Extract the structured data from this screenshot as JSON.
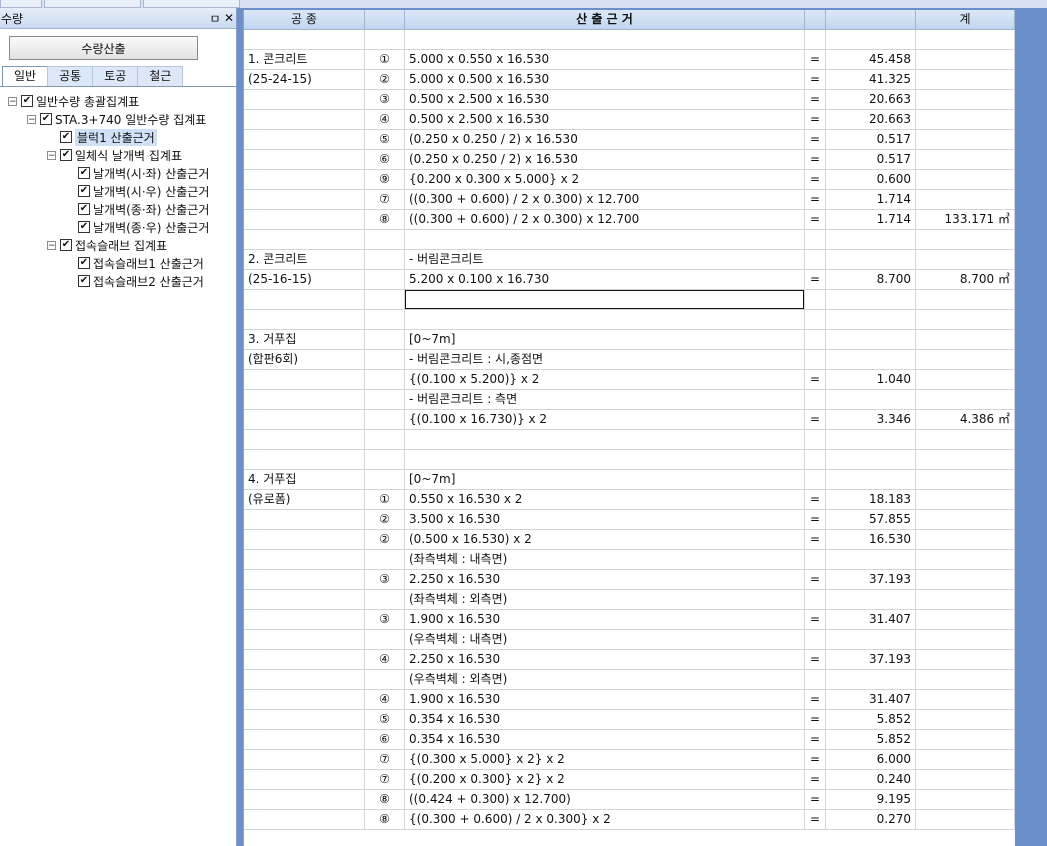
{
  "panel": {
    "title": "수량",
    "pin_glyph": "ㅁ",
    "close_glyph": "✕",
    "calc_button": "수량산출",
    "tabs": [
      "일반",
      "공통",
      "토공",
      "철근"
    ],
    "tree": [
      {
        "label": "일반수량 총괄집계표",
        "level": 0,
        "expander": "−",
        "checked": true
      },
      {
        "label": "STA.3+740 일반수량 집계표",
        "level": 1,
        "expander": "−",
        "checked": true
      },
      {
        "label": "블럭1 산출근거",
        "level": 2,
        "expander": "",
        "checked": true,
        "selected": true
      },
      {
        "label": "일체식 날개벽 집계표",
        "level": 2,
        "expander": "−",
        "checked": true
      },
      {
        "label": "날개벽(시·좌) 산출근거",
        "level": 3,
        "expander": "",
        "checked": true
      },
      {
        "label": "날개벽(시·우) 산출근거",
        "level": 3,
        "expander": "",
        "checked": true
      },
      {
        "label": "날개벽(종·좌) 산출근거",
        "level": 3,
        "expander": "",
        "checked": true
      },
      {
        "label": "날개벽(종·우) 산출근거",
        "level": 3,
        "expander": "",
        "checked": true
      },
      {
        "label": "접속슬래브 집계표",
        "level": 2,
        "expander": "−",
        "checked": true
      },
      {
        "label": "접속슬래브1 산출근거",
        "level": 3,
        "expander": "",
        "checked": true
      },
      {
        "label": "접속슬래브2 산출근거",
        "level": 3,
        "expander": "",
        "checked": true
      }
    ]
  },
  "sheet": {
    "headers": [
      "공 종",
      "",
      "산 출 근 거",
      "",
      "",
      "계"
    ],
    "rows": [
      [
        "",
        "",
        "",
        "",
        "",
        ""
      ],
      [
        "1. 콘크리트",
        "①",
        "5.000 x 0.550 x 16.530",
        "=",
        "45.458",
        ""
      ],
      [
        "(25-24-15)",
        "②",
        "5.000 x 0.500 x 16.530",
        "=",
        "41.325",
        ""
      ],
      [
        "",
        "③",
        "0.500 x 2.500 x 16.530",
        "=",
        "20.663",
        ""
      ],
      [
        "",
        "④",
        "0.500 x 2.500 x 16.530",
        "=",
        "20.663",
        ""
      ],
      [
        "",
        "⑤",
        "(0.250 x 0.250 / 2) x 16.530",
        "=",
        "0.517",
        ""
      ],
      [
        "",
        "⑥",
        "(0.250 x 0.250 / 2) x 16.530",
        "=",
        "0.517",
        ""
      ],
      [
        "",
        "⑨",
        "{0.200 x 0.300 x 5.000} x 2",
        "=",
        "0.600",
        ""
      ],
      [
        "",
        "⑦",
        "((0.300 + 0.600) / 2 x 0.300) x 12.700",
        "=",
        "1.714",
        ""
      ],
      [
        "",
        "⑧",
        "((0.300 + 0.600) / 2 x 0.300) x 12.700",
        "=",
        "1.714",
        "133.171 ㎥"
      ],
      [
        "",
        "",
        "",
        "",
        "",
        ""
      ],
      [
        "2. 콘크리트",
        "",
        "- 버림콘크리트",
        "",
        "",
        ""
      ],
      [
        "(25-16-15)",
        "",
        "5.200 x 0.100 x 16.730",
        "=",
        "8.700",
        "8.700 ㎥"
      ],
      [
        "",
        "",
        "",
        "",
        "",
        ""
      ],
      [
        "",
        "",
        "",
        "",
        "",
        ""
      ],
      [
        "3. 거푸집",
        "",
        "[0~7m]",
        "",
        "",
        ""
      ],
      [
        "(합판6회)",
        "",
        "- 버림콘크리트 : 시,종점면",
        "",
        "",
        ""
      ],
      [
        "",
        "",
        "{(0.100 x 5.200)} x 2",
        "=",
        "1.040",
        ""
      ],
      [
        "",
        "",
        "- 버림콘크리트 : 측면",
        "",
        "",
        ""
      ],
      [
        "",
        "",
        "{(0.100 x 16.730)} x 2",
        "=",
        "3.346",
        "4.386 ㎡"
      ],
      [
        "",
        "",
        "",
        "",
        "",
        ""
      ],
      [
        "",
        "",
        "",
        "",
        "",
        ""
      ],
      [
        "4. 거푸집",
        "",
        "[0~7m]",
        "",
        "",
        ""
      ],
      [
        "(유로폼)",
        "①",
        "0.550 x 16.530 x 2",
        "=",
        "18.183",
        ""
      ],
      [
        "",
        "②",
        "3.500 x 16.530",
        "=",
        "57.855",
        ""
      ],
      [
        "",
        "②",
        "(0.500 x 16.530) x 2",
        "=",
        "16.530",
        ""
      ],
      [
        "",
        "",
        "(좌측벽체 : 내측면)",
        "",
        "",
        ""
      ],
      [
        "",
        "③",
        "2.250 x 16.530",
        "=",
        "37.193",
        ""
      ],
      [
        "",
        "",
        "(좌측벽체 : 외측면)",
        "",
        "",
        ""
      ],
      [
        "",
        "③",
        "1.900 x 16.530",
        "=",
        "31.407",
        ""
      ],
      [
        "",
        "",
        "(우측벽체 : 내측면)",
        "",
        "",
        ""
      ],
      [
        "",
        "④",
        "2.250 x 16.530",
        "=",
        "37.193",
        ""
      ],
      [
        "",
        "",
        "(우측벽체 : 외측면)",
        "",
        "",
        ""
      ],
      [
        "",
        "④",
        "1.900 x 16.530",
        "=",
        "31.407",
        ""
      ],
      [
        "",
        "⑤",
        "0.354 x 16.530",
        "=",
        "5.852",
        ""
      ],
      [
        "",
        "⑥",
        "0.354 x 16.530",
        "=",
        "5.852",
        ""
      ],
      [
        "",
        "⑦",
        "{(0.300 x 5.000} x 2} x 2",
        "=",
        "6.000",
        ""
      ],
      [
        "",
        "⑦",
        "{(0.200 x 0.300} x 2} x 2",
        "=",
        "0.240",
        ""
      ],
      [
        "",
        "⑧",
        "((0.424 + 0.300) x 12.700)",
        "=",
        "9.195",
        ""
      ],
      [
        "",
        "⑧",
        "{(0.300 + 0.600) / 2 x 0.300} x 2",
        "=",
        "0.270",
        ""
      ]
    ],
    "edit_row_index": 13
  }
}
